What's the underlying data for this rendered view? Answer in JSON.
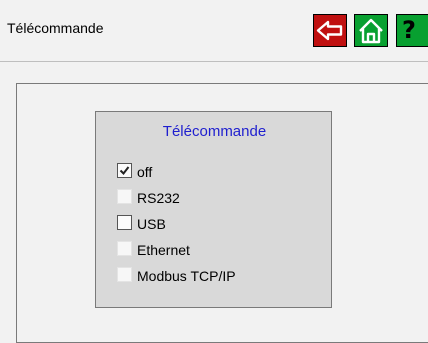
{
  "header": {
    "title": "Télécommande",
    "buttons": [
      {
        "name": "back",
        "icon": "arrow-left-icon",
        "color": "#c01010"
      },
      {
        "name": "home",
        "icon": "home-icon",
        "color": "#08a030"
      },
      {
        "name": "help",
        "icon": "question-icon",
        "label": "?",
        "color": "#08a030"
      }
    ]
  },
  "panel": {
    "title": "Télécommande",
    "title_color": "#1f1fcf",
    "options": [
      {
        "label": "off",
        "checked": true
      },
      {
        "label": "RS232",
        "checked": false
      },
      {
        "label": "USB",
        "checked": false
      },
      {
        "label": "Ethernet",
        "checked": false
      },
      {
        "label": "Modbus TCP/IP",
        "checked": false
      }
    ]
  }
}
